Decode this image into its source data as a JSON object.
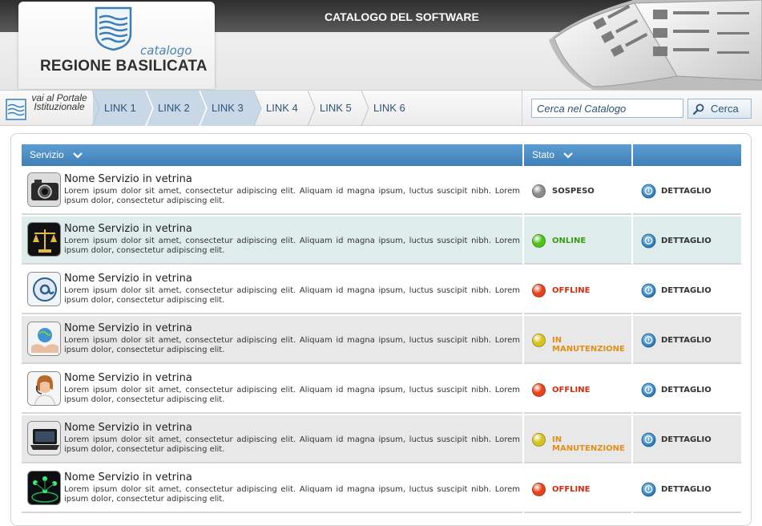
{
  "header": {
    "title": "CATALOGO DEL SOFTWARE",
    "logo_sub": "catalogo",
    "logo_name": "REGIONE BASILICATA"
  },
  "nav": {
    "portal_label": "vai al Portale Istituzionale",
    "links": [
      {
        "label": "LINK 1",
        "active": true
      },
      {
        "label": "LINK 2",
        "active": true
      },
      {
        "label": "LINK 3",
        "active": true
      },
      {
        "label": "LINK 4",
        "active": false
      },
      {
        "label": "LINK 5",
        "active": false
      },
      {
        "label": "LINK 6",
        "active": false
      }
    ]
  },
  "search": {
    "placeholder": "Cerca nel Catalogo",
    "button_label": "Cerca"
  },
  "table": {
    "col_servizio": "Servizio",
    "col_stato": "Stato",
    "rows": [
      {
        "name": "Nome Servizio in vetrina",
        "desc": "Lorem ipsum dolor sit amet, consectetur adipiscing elit. Aliquam id magna ipsum, luctus suscipit nibh. Lorem ipsum dolor, consectetur adipiscing elit.",
        "status": "SOSPESO",
        "status_color": "#8a8a8a",
        "status_text_color": "#333333",
        "bg": "#ffffff",
        "icon": "camera-icon",
        "detail": "DETTAGLIO"
      },
      {
        "name": "Nome Servizio in vetrina",
        "desc": "Lorem ipsum dolor sit amet, consectetur adipiscing elit. Aliquam id magna ipsum, luctus suscipit nibh. Lorem ipsum dolor, consectetur adipiscing elit.",
        "status": "ONLINE",
        "status_color": "#4fc21a",
        "status_text_color": "#3a9a12",
        "bg": "#dfecec",
        "icon": "scales-icon",
        "detail": "DETTAGLIO"
      },
      {
        "name": "Nome Servizio in vetrina",
        "desc": "Lorem ipsum dolor sit amet, consectetur adipiscing elit. Aliquam id magna ipsum, luctus suscipit nibh. Lorem ipsum dolor, consectetur adipiscing elit.",
        "status": "OFFLINE",
        "status_color": "#e8421a",
        "status_text_color": "#d42c10",
        "bg": "#ffffff",
        "icon": "at-sign-icon",
        "detail": "DETTAGLIO"
      },
      {
        "name": "Nome Servizio in vetrina",
        "desc": "Lorem ipsum dolor sit amet, consectetur adipiscing elit. Aliquam id magna ipsum, luctus suscipit nibh. Lorem ipsum dolor, consectetur adipiscing elit.",
        "status": "IN MANUTENZIONE",
        "status_color": "#d6c41e",
        "status_text_color": "#e09018",
        "bg": "#e8e8e8",
        "icon": "globe-hands-icon",
        "detail": "DETTAGLIO"
      },
      {
        "name": "Nome Servizio in vetrina",
        "desc": "Lorem ipsum dolor sit amet, consectetur adipiscing elit. Aliquam id magna ipsum, luctus suscipit nibh. Lorem ipsum dolor, consectetur adipiscing elit.",
        "status": "OFFLINE",
        "status_color": "#e8421a",
        "status_text_color": "#d42c10",
        "bg": "#ffffff",
        "icon": "operator-headset-icon",
        "detail": "DETTAGLIO"
      },
      {
        "name": "Nome Servizio in vetrina",
        "desc": "Lorem ipsum dolor sit amet, consectetur adipiscing elit. Aliquam id magna ipsum, luctus suscipit nibh. Lorem ipsum dolor, consectetur adipiscing elit.",
        "status": "IN MANUTENZIONE",
        "status_color": "#d6c41e",
        "status_text_color": "#e09018",
        "bg": "#e8e8e8",
        "icon": "laptop-icon",
        "detail": "DETTAGLIO"
      },
      {
        "name": "Nome Servizio in vetrina",
        "desc": "Lorem ipsum dolor sit amet, consectetur adipiscing elit. Aliquam id magna ipsum, luctus suscipit nibh. Lorem ipsum dolor, consectetur adipiscing elit.",
        "status": "OFFLINE",
        "status_color": "#e8421a",
        "status_text_color": "#d42c10",
        "bg": "#ffffff",
        "icon": "network-icon",
        "detail": "DETTAGLIO"
      }
    ]
  }
}
